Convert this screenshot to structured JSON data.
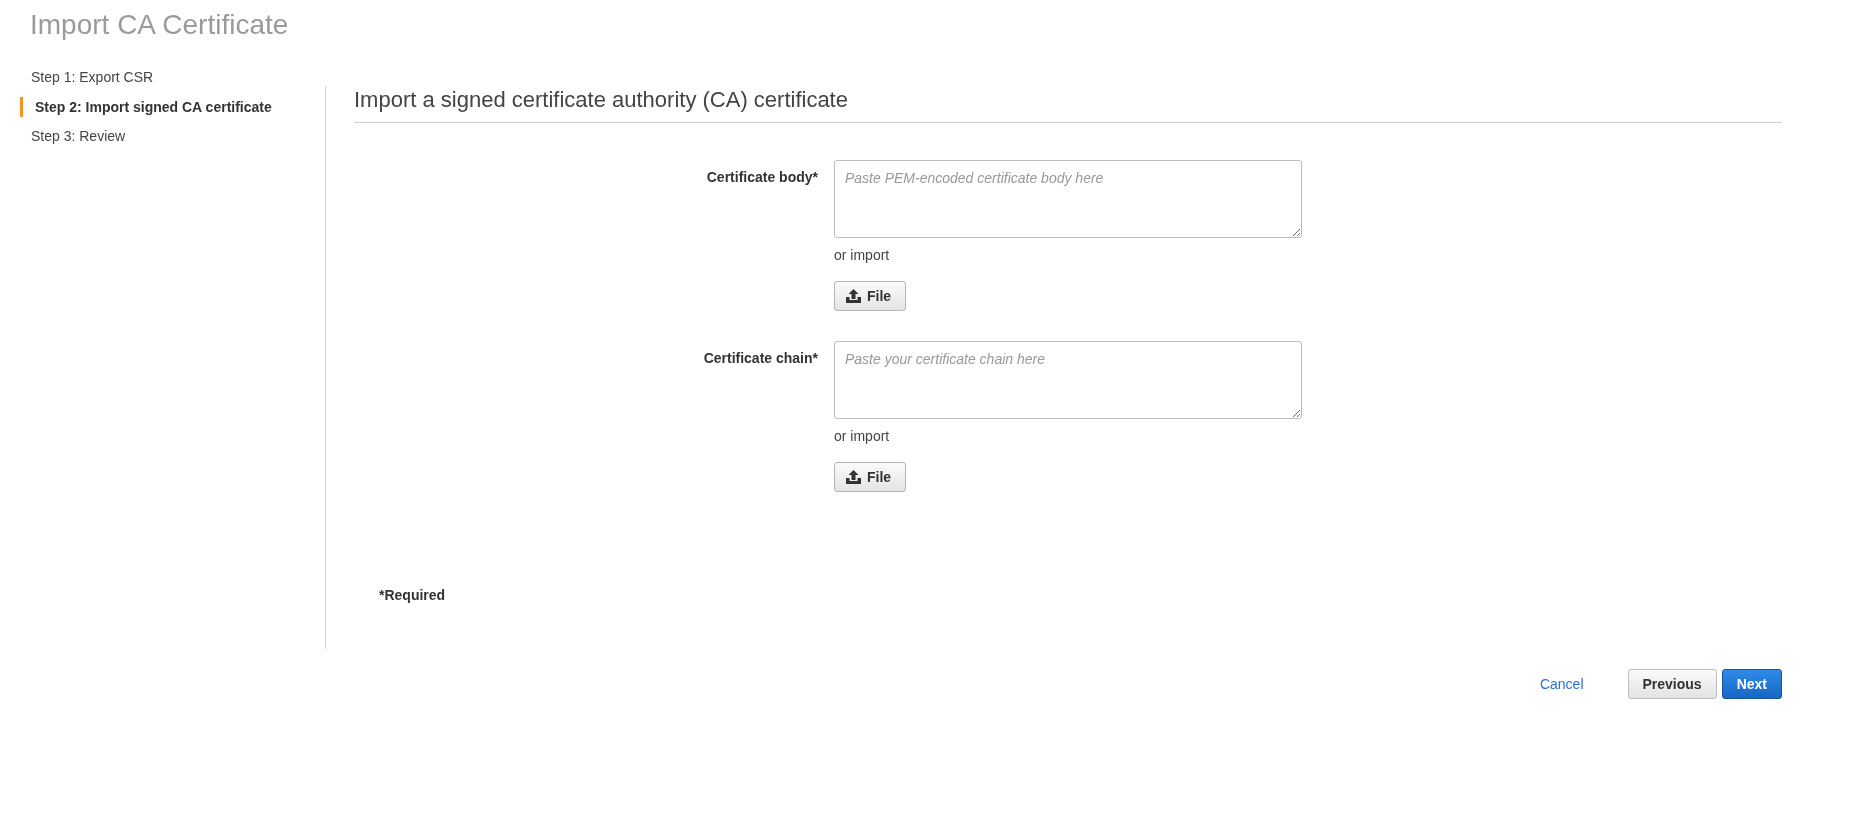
{
  "page": {
    "title": "Import CA Certificate"
  },
  "steps": [
    {
      "label": "Step 1: Export CSR",
      "selected": false
    },
    {
      "label": "Step 2: Import signed CA certificate",
      "selected": true
    },
    {
      "label": "Step 3: Review",
      "selected": false
    }
  ],
  "section": {
    "heading": "Import a signed certificate authority (CA) certificate"
  },
  "fields": [
    {
      "label": "Certificate body*",
      "placeholder": "Paste PEM-encoded certificate body here",
      "alt_text": "or import",
      "button": "File"
    },
    {
      "label": "Certificate chain*",
      "placeholder": "Paste your certificate chain here",
      "alt_text": "or import",
      "button": "File"
    }
  ],
  "required_note": "*Required",
  "buttons": [
    {
      "label": "Cancel",
      "kind": "link"
    },
    {
      "label": "Previous",
      "kind": "secondary"
    },
    {
      "label": "Next",
      "kind": "primary"
    }
  ]
}
